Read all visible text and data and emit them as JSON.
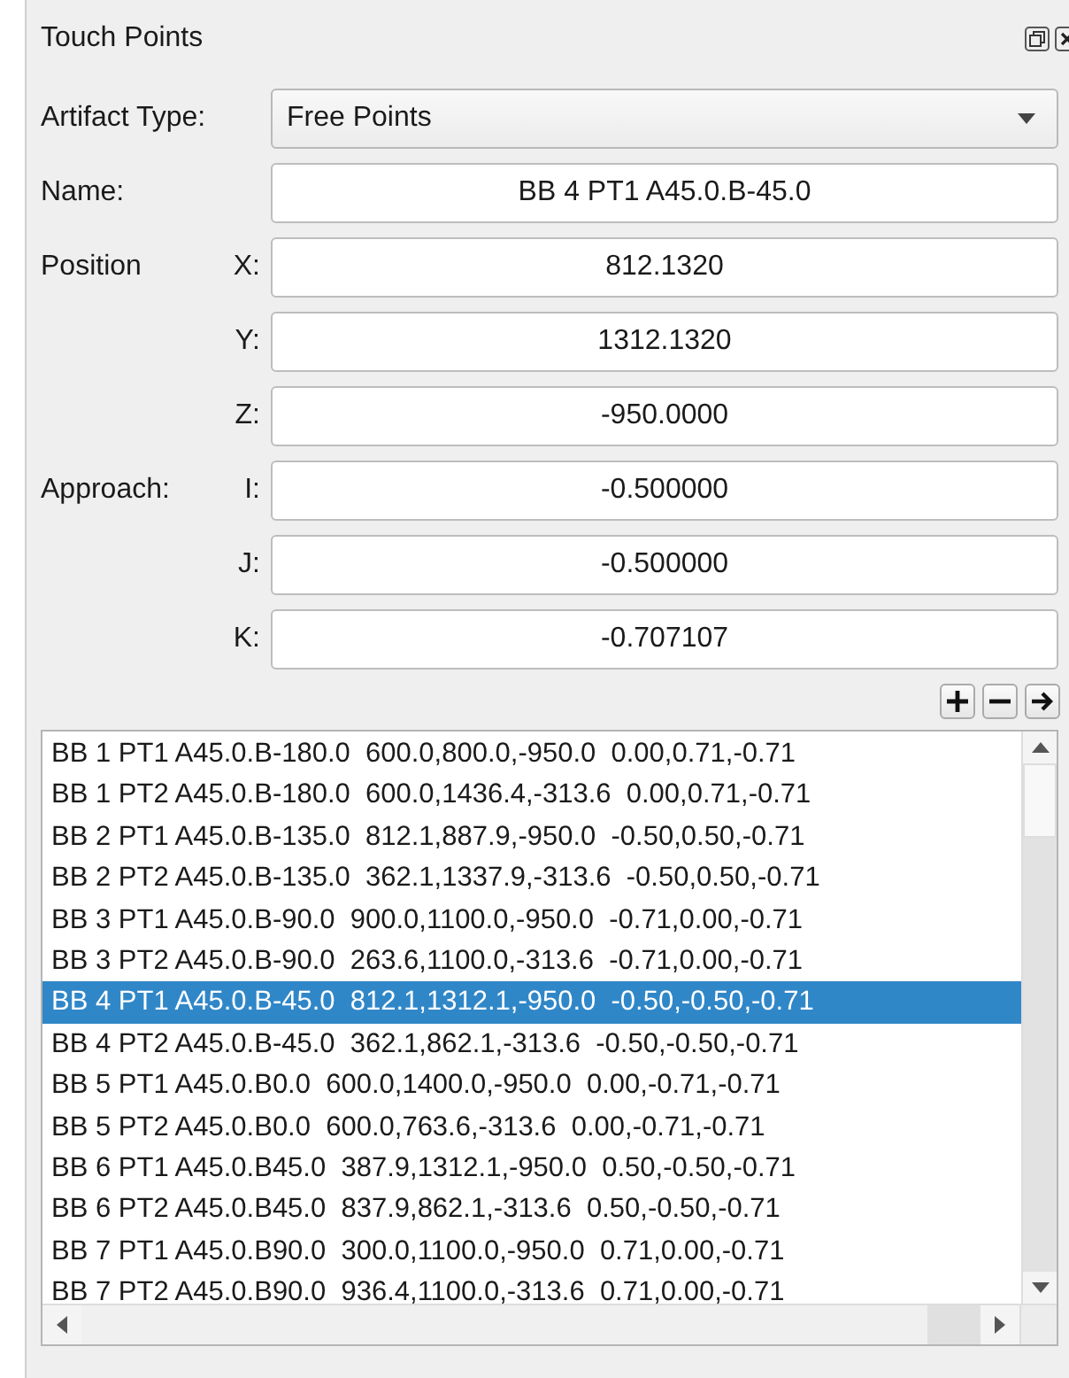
{
  "panel": {
    "title": "Touch Points"
  },
  "artifact_type": {
    "label": "Artifact Type:",
    "value": "Free Points"
  },
  "name": {
    "label": "Name:",
    "value": "BB 4 PT1 A45.0.B-45.0"
  },
  "groups": [
    {
      "label": "Position",
      "fields": [
        {
          "axis": "X:",
          "value": "812.1320"
        },
        {
          "axis": "Y:",
          "value": "1312.1320"
        },
        {
          "axis": "Z:",
          "value": "-950.0000"
        }
      ]
    },
    {
      "label": "Approach:",
      "fields": [
        {
          "axis": "I:",
          "value": "-0.500000"
        },
        {
          "axis": "J:",
          "value": "-0.500000"
        },
        {
          "axis": "K:",
          "value": "-0.707107"
        }
      ]
    }
  ],
  "points": [
    {
      "text": "BB 1 PT1 A45.0.B-180.0  600.0,800.0,-950.0  0.00,0.71,-0.71",
      "selected": false
    },
    {
      "text": "BB 1 PT2 A45.0.B-180.0  600.0,1436.4,-313.6  0.00,0.71,-0.71",
      "selected": false
    },
    {
      "text": "BB 2 PT1 A45.0.B-135.0  812.1,887.9,-950.0  -0.50,0.50,-0.71",
      "selected": false
    },
    {
      "text": "BB 2 PT2 A45.0.B-135.0  362.1,1337.9,-313.6  -0.50,0.50,-0.71",
      "selected": false
    },
    {
      "text": "BB 3 PT1 A45.0.B-90.0  900.0,1100.0,-950.0  -0.71,0.00,-0.71",
      "selected": false
    },
    {
      "text": "BB 3 PT2 A45.0.B-90.0  263.6,1100.0,-313.6  -0.71,0.00,-0.71",
      "selected": false
    },
    {
      "text": "BB 4 PT1 A45.0.B-45.0  812.1,1312.1,-950.0  -0.50,-0.50,-0.71",
      "selected": true
    },
    {
      "text": "BB 4 PT2 A45.0.B-45.0  362.1,862.1,-313.6  -0.50,-0.50,-0.71",
      "selected": false
    },
    {
      "text": "BB 5 PT1 A45.0.B0.0  600.0,1400.0,-950.0  0.00,-0.71,-0.71",
      "selected": false
    },
    {
      "text": "BB 5 PT2 A45.0.B0.0  600.0,763.6,-313.6  0.00,-0.71,-0.71",
      "selected": false
    },
    {
      "text": "BB 6 PT1 A45.0.B45.0  387.9,1312.1,-950.0  0.50,-0.50,-0.71",
      "selected": false
    },
    {
      "text": "BB 6 PT2 A45.0.B45.0  837.9,862.1,-313.6  0.50,-0.50,-0.71",
      "selected": false
    },
    {
      "text": "BB 7 PT1 A45.0.B90.0  300.0,1100.0,-950.0  0.71,0.00,-0.71",
      "selected": false
    },
    {
      "text": "BB 7 PT2 A45.0.B90.0  936.4,1100.0,-313.6  0.71,0.00,-0.71",
      "selected": false
    }
  ]
}
